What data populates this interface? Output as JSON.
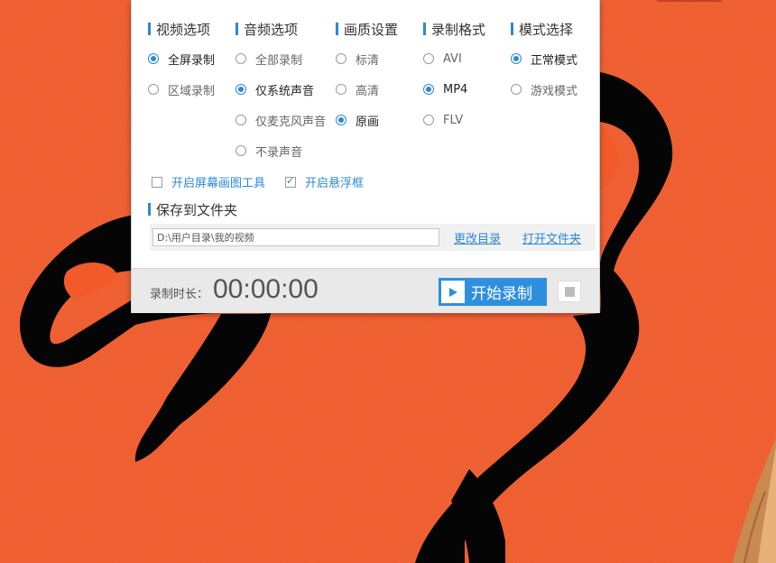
{
  "panel": {
    "columns": [
      {
        "title": "视频选项",
        "options": [
          {
            "label": "全屏录制",
            "selected": true
          },
          {
            "label": "区域录制",
            "selected": false
          }
        ]
      },
      {
        "title": "音频选项",
        "options": [
          {
            "label": "全部录制",
            "selected": false
          },
          {
            "label": "仅系统声音",
            "selected": true
          },
          {
            "label": "仅麦克风声音",
            "selected": false
          },
          {
            "label": "不录声音",
            "selected": false
          }
        ]
      },
      {
        "title": "画质设置",
        "options": [
          {
            "label": "标清",
            "selected": false
          },
          {
            "label": "高清",
            "selected": false
          },
          {
            "label": "原画",
            "selected": true
          }
        ]
      },
      {
        "title": "录制格式",
        "options": [
          {
            "label": "AVI",
            "selected": false
          },
          {
            "label": "MP4",
            "selected": true
          },
          {
            "label": "FLV",
            "selected": false
          }
        ]
      },
      {
        "title": "模式选择",
        "options": [
          {
            "label": "正常模式",
            "selected": true
          },
          {
            "label": "游戏模式",
            "selected": false
          }
        ]
      }
    ],
    "checkboxes": [
      {
        "label": "开启屏幕画图工具",
        "checked": false
      },
      {
        "label": "开启悬浮框",
        "checked": true
      }
    ],
    "save": {
      "title": "保存到文件夹",
      "path": "D:\\用户目录\\我的视频",
      "change_dir": "更改目录",
      "open_folder": "打开文件夹"
    },
    "footer": {
      "duration_label": "录制时长：",
      "duration_value": "00:00:00",
      "start_label": "开始录制"
    }
  },
  "colors": {
    "accent": "#2b88d8",
    "button": "#2e8fe0",
    "wallpaper": "#f25a2a",
    "check_mark": "#2a9a2a"
  },
  "icons": [
    "play-icon",
    "stop-icon",
    "check-icon"
  ]
}
